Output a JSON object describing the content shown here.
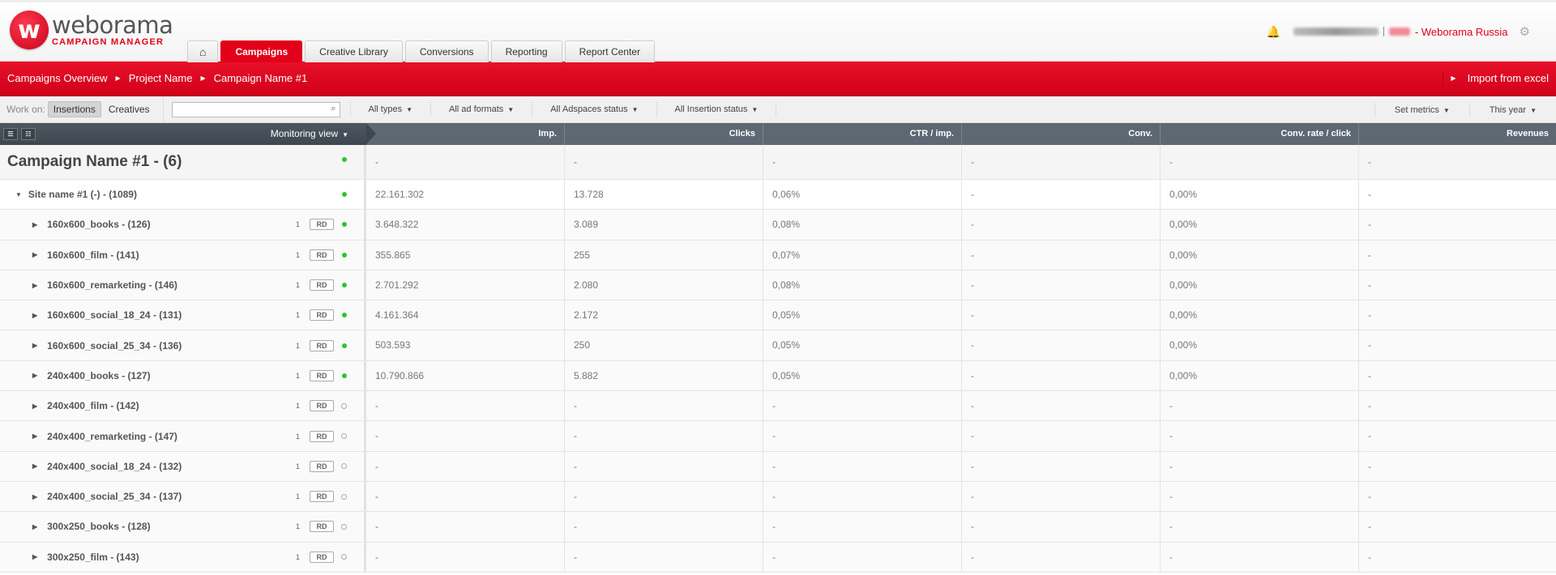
{
  "brand": {
    "name": "weborama",
    "sub": "CAMPAIGN MANAGER",
    "mark": "w"
  },
  "tabs": [
    {
      "label": "Campaigns",
      "active": true
    },
    {
      "label": "Creative Library",
      "active": false
    },
    {
      "label": "Conversions",
      "active": false
    },
    {
      "label": "Reporting",
      "active": false
    },
    {
      "label": "Report Center",
      "active": false
    }
  ],
  "user": {
    "company": "- Weborama Russia"
  },
  "breadcrumb": [
    "Campaigns Overview",
    "Project Name",
    "Campaign Name #1"
  ],
  "import_label": "Import from excel",
  "toolbar": {
    "work_on": "Work on:",
    "insertions": "Insertions",
    "creatives": "Creatives",
    "search_value": "",
    "filters": [
      "All types",
      "All ad formats",
      "All Adspaces status",
      "All Insertion status"
    ],
    "set_metrics": "Set metrics",
    "period": "This year"
  },
  "table": {
    "view_label": "Monitoring view",
    "columns": [
      "Imp.",
      "Clicks",
      "CTR / imp.",
      "Conv.",
      "Conv. rate / click",
      "Revenues"
    ],
    "campaign": {
      "name": "Campaign Name #1 - (6)",
      "values": [
        "-",
        "-",
        "-",
        "-",
        "-",
        "-"
      ]
    },
    "site": {
      "name": "Site name #1 (-) - (1089)",
      "values": [
        "22.161.302",
        "13.728",
        "0,06%",
        "-",
        "0,00%",
        "-"
      ]
    },
    "rows": [
      {
        "name": "160x600_books - (126)",
        "count": "1",
        "badge": "RD",
        "status": "active",
        "values": [
          "3.648.322",
          "3.089",
          "0,08%",
          "-",
          "0,00%",
          "-"
        ]
      },
      {
        "name": "160x600_film - (141)",
        "count": "1",
        "badge": "RD",
        "status": "active",
        "values": [
          "355.865",
          "255",
          "0,07%",
          "-",
          "0,00%",
          "-"
        ]
      },
      {
        "name": "160x600_remarketing - (146)",
        "count": "1",
        "badge": "RD",
        "status": "active",
        "values": [
          "2.701.292",
          "2.080",
          "0,08%",
          "-",
          "0,00%",
          "-"
        ]
      },
      {
        "name": "160x600_social_18_24 - (131)",
        "count": "1",
        "badge": "RD",
        "status": "active",
        "values": [
          "4.161.364",
          "2.172",
          "0,05%",
          "-",
          "0,00%",
          "-"
        ]
      },
      {
        "name": "160x600_social_25_34 - (136)",
        "count": "1",
        "badge": "RD",
        "status": "active",
        "values": [
          "503.593",
          "250",
          "0,05%",
          "-",
          "0,00%",
          "-"
        ]
      },
      {
        "name": "240x400_books - (127)",
        "count": "1",
        "badge": "RD",
        "status": "active",
        "values": [
          "10.790.866",
          "5.882",
          "0,05%",
          "-",
          "0,00%",
          "-"
        ]
      },
      {
        "name": "240x400_film - (142)",
        "count": "1",
        "badge": "RD",
        "status": "inactive",
        "values": [
          "-",
          "-",
          "-",
          "-",
          "-",
          "-"
        ]
      },
      {
        "name": "240x400_remarketing - (147)",
        "count": "1",
        "badge": "RD",
        "status": "inactive",
        "values": [
          "-",
          "-",
          "-",
          "-",
          "-",
          "-"
        ]
      },
      {
        "name": "240x400_social_18_24 - (132)",
        "count": "1",
        "badge": "RD",
        "status": "inactive",
        "values": [
          "-",
          "-",
          "-",
          "-",
          "-",
          "-"
        ]
      },
      {
        "name": "240x400_social_25_34 - (137)",
        "count": "1",
        "badge": "RD",
        "status": "inactive",
        "values": [
          "-",
          "-",
          "-",
          "-",
          "-",
          "-"
        ]
      },
      {
        "name": "300x250_books - (128)",
        "count": "1",
        "badge": "RD",
        "status": "inactive",
        "values": [
          "-",
          "-",
          "-",
          "-",
          "-",
          "-"
        ]
      },
      {
        "name": "300x250_film - (143)",
        "count": "1",
        "badge": "RD",
        "status": "inactive",
        "values": [
          "-",
          "-",
          "-",
          "-",
          "-",
          "-"
        ]
      }
    ]
  },
  "colors": {
    "accent": "#e2001a",
    "header_dark": "#5d6872",
    "status_active": "#2fc42f"
  }
}
